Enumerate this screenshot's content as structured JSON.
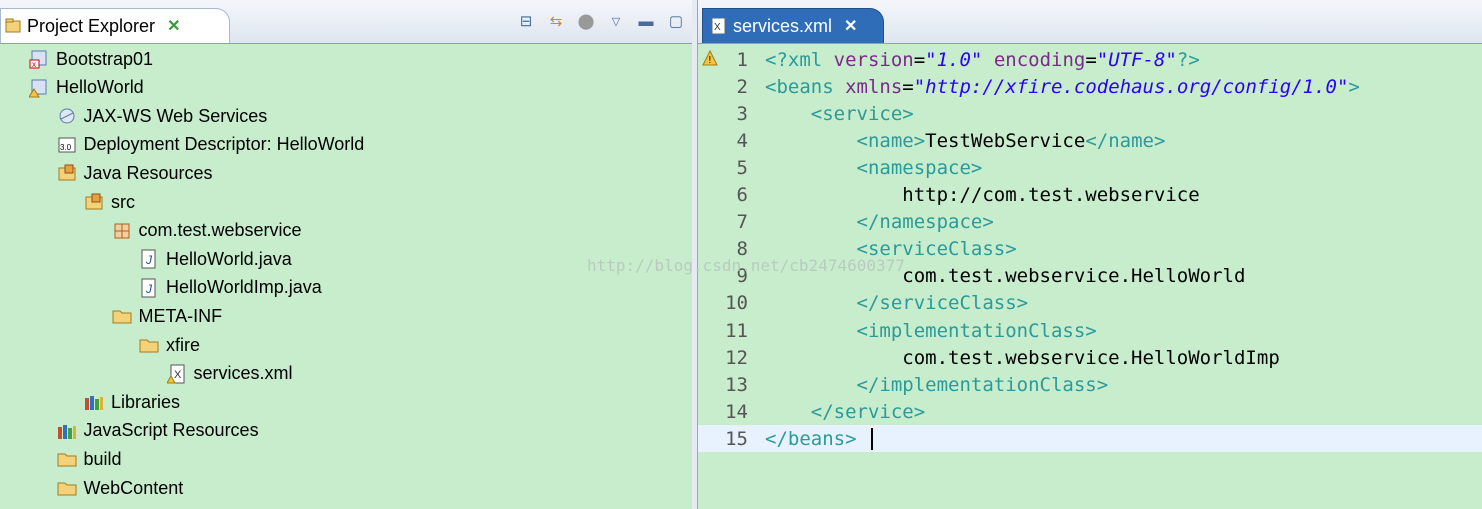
{
  "left_tab": {
    "title": "Project Explorer"
  },
  "left_toolbar": [
    "collapse-all",
    "link-with-editor",
    "filters",
    "view-menu",
    "minimize",
    "maximize"
  ],
  "tree": [
    {
      "label": "Bootstrap01",
      "icon": "project-error-icon",
      "depth": 0
    },
    {
      "label": "HelloWorld",
      "icon": "project-warning-icon",
      "depth": 0
    },
    {
      "label": "JAX-WS Web Services",
      "icon": "webservices-icon",
      "depth": 1
    },
    {
      "label": "Deployment Descriptor: HelloWorld",
      "icon": "deployment-descriptor-icon",
      "depth": 1
    },
    {
      "label": "Java Resources",
      "icon": "java-resources-icon",
      "depth": 1
    },
    {
      "label": "src",
      "icon": "source-folder-icon",
      "depth": 2
    },
    {
      "label": "com.test.webservice",
      "icon": "package-icon",
      "depth": 3
    },
    {
      "label": "HelloWorld.java",
      "icon": "java-file-icon",
      "depth": 4
    },
    {
      "label": "HelloWorldImp.java",
      "icon": "java-file-icon",
      "depth": 4
    },
    {
      "label": "META-INF",
      "icon": "folder-icon",
      "depth": 3
    },
    {
      "label": "xfire",
      "icon": "folder-icon",
      "depth": 4
    },
    {
      "label": "services.xml",
      "icon": "xml-file-warning-icon",
      "depth": 5
    },
    {
      "label": "Libraries",
      "icon": "libraries-icon",
      "depth": 2
    },
    {
      "label": "JavaScript Resources",
      "icon": "libraries-icon",
      "depth": 1
    },
    {
      "label": "build",
      "icon": "folder-icon",
      "depth": 1
    },
    {
      "label": "WebContent",
      "icon": "folder-icon",
      "depth": 1
    }
  ],
  "editor_tab": {
    "title": "services.xml"
  },
  "editor": {
    "current_line": 15,
    "lines": [
      {
        "n": "1",
        "parts": [
          [
            "t-tag",
            "<?xml "
          ],
          [
            "t-attr",
            "version"
          ],
          [
            "t-text",
            "="
          ],
          [
            "t-str",
            "\"1.0\""
          ],
          [
            "t-text",
            " "
          ],
          [
            "t-attr",
            "encoding"
          ],
          [
            "t-text",
            "="
          ],
          [
            "t-str",
            "\"UTF-8\""
          ],
          [
            "t-tag",
            "?>"
          ]
        ]
      },
      {
        "n": "2",
        "parts": [
          [
            "t-tag",
            "<beans "
          ],
          [
            "t-attr",
            "xmlns"
          ],
          [
            "t-text",
            "="
          ],
          [
            "t-str",
            "\"http://xfire.codehaus.org/config/1.0\""
          ],
          [
            "t-tag",
            ">"
          ]
        ]
      },
      {
        "n": "3",
        "parts": [
          [
            "t-text",
            "    "
          ],
          [
            "t-tag",
            "<service>"
          ]
        ]
      },
      {
        "n": "4",
        "parts": [
          [
            "t-text",
            "        "
          ],
          [
            "t-tag",
            "<name>"
          ],
          [
            "t-text",
            "TestWebService"
          ],
          [
            "t-tag",
            "</name>"
          ]
        ]
      },
      {
        "n": "5",
        "parts": [
          [
            "t-text",
            "        "
          ],
          [
            "t-tag",
            "<namespace>"
          ]
        ]
      },
      {
        "n": "6",
        "parts": [
          [
            "t-text",
            "            http://com.test.webservice"
          ]
        ]
      },
      {
        "n": "7",
        "parts": [
          [
            "t-text",
            "        "
          ],
          [
            "t-tag",
            "</namespace>"
          ]
        ]
      },
      {
        "n": "8",
        "parts": [
          [
            "t-text",
            "        "
          ],
          [
            "t-tag",
            "<serviceClass>"
          ]
        ]
      },
      {
        "n": "9",
        "parts": [
          [
            "t-text",
            "            com.test.webservice.HelloWorld"
          ]
        ]
      },
      {
        "n": "10",
        "parts": [
          [
            "t-text",
            "        "
          ],
          [
            "t-tag",
            "</serviceClass>"
          ]
        ]
      },
      {
        "n": "11",
        "parts": [
          [
            "t-text",
            "        "
          ],
          [
            "t-tag",
            "<implementationClass>"
          ]
        ]
      },
      {
        "n": "12",
        "parts": [
          [
            "t-text",
            "            com.test.webservice.HelloWorldImp"
          ]
        ]
      },
      {
        "n": "13",
        "parts": [
          [
            "t-text",
            "        "
          ],
          [
            "t-tag",
            "</implementationClass>"
          ]
        ]
      },
      {
        "n": "14",
        "parts": [
          [
            "t-text",
            "    "
          ],
          [
            "t-tag",
            "</service>"
          ]
        ]
      },
      {
        "n": "15",
        "parts": [
          [
            "t-tag",
            "</beans>"
          ]
        ]
      }
    ]
  },
  "watermark": "http://blog.csdn.net/cb2474600377",
  "colors": {
    "background": "#c7edcc",
    "tab_active": "#2f6db8",
    "tag": "#2a9a9a",
    "attr": "#7a2a8a",
    "string": "#2a00ff"
  }
}
